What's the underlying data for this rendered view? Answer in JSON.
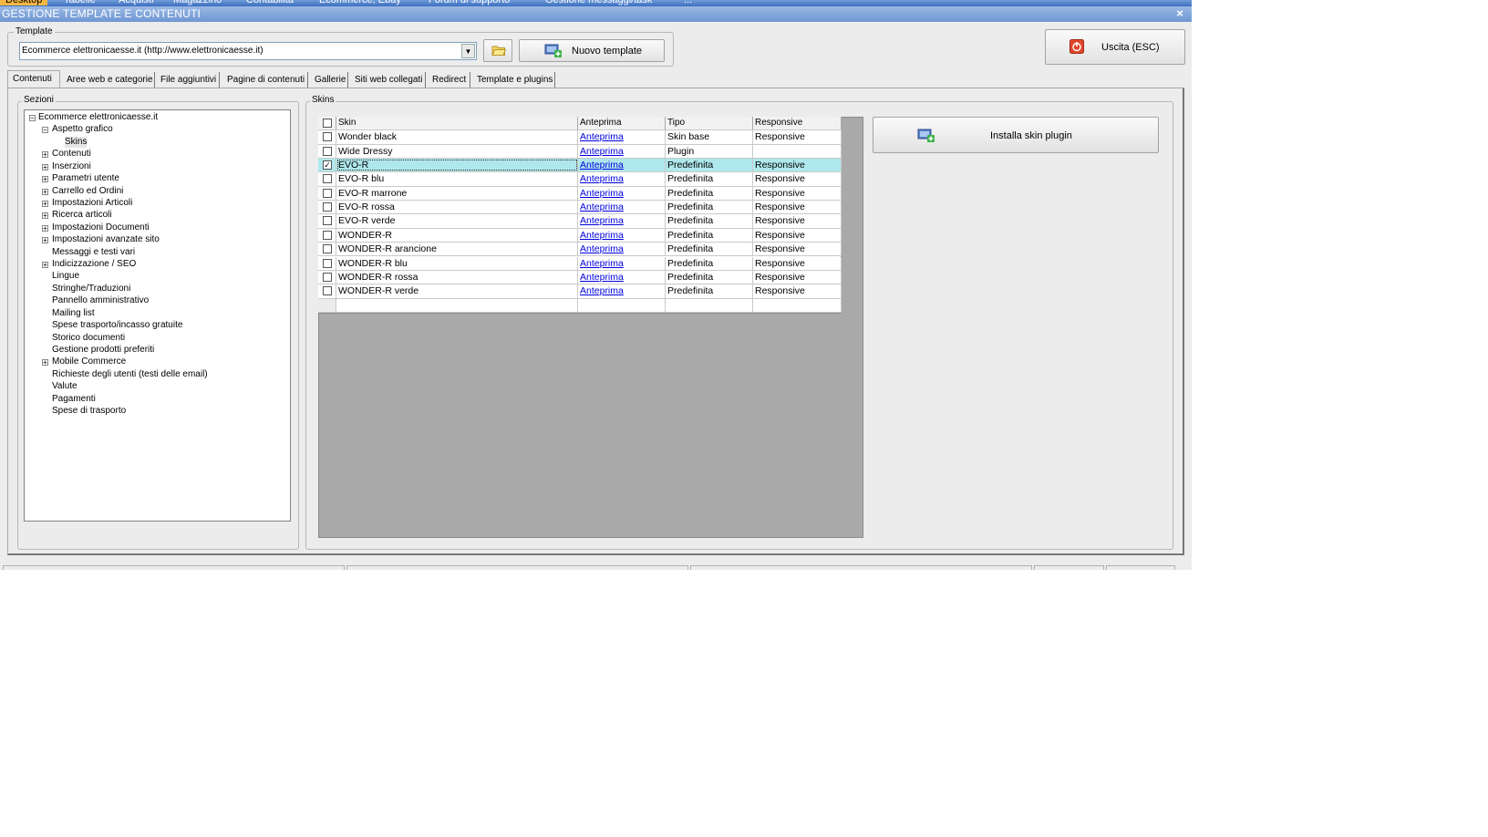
{
  "top_menu": [
    "Desktop",
    "Tabelle",
    "Acquisti",
    "Magazzino",
    "Contabilità",
    "Ecommerce, Ebay",
    "Forum di supporto",
    "Gestione messaggi/task",
    "..."
  ],
  "window": {
    "title": "GESTIONE TEMPLATE E CONTENUTI",
    "close_symbol": "×"
  },
  "template": {
    "legend": "Template",
    "selected": "Ecommerce elettronicaesse.it (http://www.elettronicaesse.it)",
    "new_button": "Nuovo template"
  },
  "exit_button": "Uscita (ESC)",
  "tabs": [
    {
      "label": "Contenuti",
      "active": true
    },
    {
      "label": "Aree web e categorie"
    },
    {
      "label": "File aggiuntivi"
    },
    {
      "label": "Pagine di contenuti"
    },
    {
      "label": "Gallerie"
    },
    {
      "label": "Siti web collegati"
    },
    {
      "label": "Redirect"
    },
    {
      "label": "Template e plugins"
    }
  ],
  "sezioni": {
    "legend": "Sezioni",
    "root": "Ecommerce elettronicaesse.it",
    "items": [
      {
        "label": "Aspetto grafico",
        "expand": "minus"
      },
      {
        "label": "Skins",
        "child": true
      },
      {
        "label": "Contenuti",
        "expand": "plus"
      },
      {
        "label": "Inserzioni",
        "expand": "plus"
      },
      {
        "label": "Parametri utente",
        "expand": "plus"
      },
      {
        "label": "Carrello ed Ordini",
        "expand": "plus"
      },
      {
        "label": "Impostazioni Articoli",
        "expand": "plus"
      },
      {
        "label": "Ricerca articoli",
        "expand": "plus"
      },
      {
        "label": "Impostazioni Documenti",
        "expand": "plus"
      },
      {
        "label": "Impostazioni avanzate sito",
        "expand": "plus"
      },
      {
        "label": "Messaggi e testi vari"
      },
      {
        "label": "Indicizzazione / SEO",
        "expand": "plus"
      },
      {
        "label": "Lingue"
      },
      {
        "label": "Stringhe/Traduzioni"
      },
      {
        "label": "Pannello amministrativo"
      },
      {
        "label": "Mailing list"
      },
      {
        "label": "Spese trasporto/incasso gratuite"
      },
      {
        "label": "Storico documenti"
      },
      {
        "label": "Gestione prodotti preferiti"
      },
      {
        "label": "Mobile Commerce",
        "expand": "plus"
      },
      {
        "label": "Richieste degli utenti (testi delle email)"
      },
      {
        "label": "Valute"
      },
      {
        "label": "Pagamenti"
      },
      {
        "label": "Spese di trasporto"
      }
    ]
  },
  "skins": {
    "legend": "Skins",
    "columns": [
      "Skin",
      "Anteprima",
      "Tipo",
      "Responsive"
    ],
    "rows": [
      {
        "skin": "Wonder black",
        "preview": "Anteprima",
        "tipo": "Skin base",
        "responsive": "Responsive",
        "checked": false
      },
      {
        "skin": "Wide Dressy",
        "preview": "Anteprima",
        "tipo": "Plugin",
        "responsive": "",
        "checked": false
      },
      {
        "skin": "EVO-R",
        "preview": "Anteprima",
        "tipo": "Predefinita",
        "responsive": "Responsive",
        "checked": true
      },
      {
        "skin": "EVO-R blu",
        "preview": "Anteprima",
        "tipo": "Predefinita",
        "responsive": "Responsive",
        "checked": false
      },
      {
        "skin": "EVO-R marrone",
        "preview": "Anteprima",
        "tipo": "Predefinita",
        "responsive": "Responsive",
        "checked": false
      },
      {
        "skin": "EVO-R rossa",
        "preview": "Anteprima",
        "tipo": "Predefinita",
        "responsive": "Responsive",
        "checked": false
      },
      {
        "skin": "EVO-R verde",
        "preview": "Anteprima",
        "tipo": "Predefinita",
        "responsive": "Responsive",
        "checked": false
      },
      {
        "skin": "WONDER-R",
        "preview": "Anteprima",
        "tipo": "Predefinita",
        "responsive": "Responsive",
        "checked": false
      },
      {
        "skin": "WONDER-R arancione",
        "preview": "Anteprima",
        "tipo": "Predefinita",
        "responsive": "Responsive",
        "checked": false
      },
      {
        "skin": "WONDER-R blu",
        "preview": "Anteprima",
        "tipo": "Predefinita",
        "responsive": "Responsive",
        "checked": false
      },
      {
        "skin": "WONDER-R rossa",
        "preview": "Anteprima",
        "tipo": "Predefinita",
        "responsive": "Responsive",
        "checked": false
      },
      {
        "skin": "WONDER-R verde",
        "preview": "Anteprima",
        "tipo": "Predefinita",
        "responsive": "Responsive",
        "checked": false
      }
    ],
    "selected_row_color": "#aee8ec",
    "install_button": "Installa skin plugin"
  },
  "icons": {
    "folder": "folder-icon",
    "new_template": "monitor-plus-icon",
    "exit": "power-icon",
    "install": "monitor-plus-icon"
  }
}
